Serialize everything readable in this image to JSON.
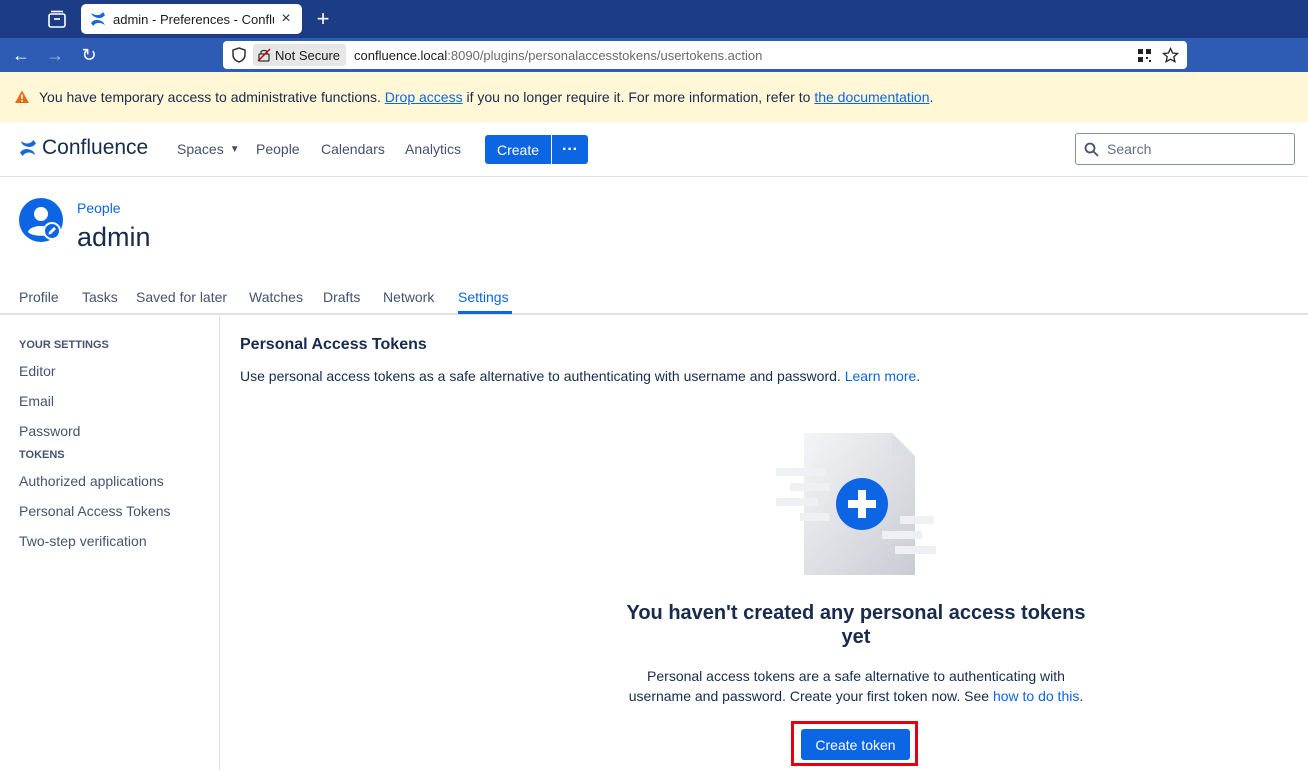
{
  "browser": {
    "tab_title": "admin - Preferences - Conflue",
    "security_label": "Not Secure",
    "url_host": "confluence.local",
    "url_rest": ":8090/plugins/personalaccesstokens/usertokens.action"
  },
  "banner": {
    "text_before": "You have temporary access to administrative functions. ",
    "link1": "Drop access",
    "text_middle": " if you no longer require it. For more information, refer to ",
    "link2": "the documentation",
    "text_after": "."
  },
  "header": {
    "logo_text": "Confluence",
    "nav": {
      "spaces": "Spaces",
      "people": "People",
      "calendars": "Calendars",
      "analytics": "Analytics"
    },
    "create_label": "Create",
    "more_label": "···",
    "search_placeholder": "Search"
  },
  "profile": {
    "breadcrumb": "People",
    "name": "admin",
    "tabs": [
      "Profile",
      "Tasks",
      "Saved for later",
      "Watches",
      "Drafts",
      "Network",
      "Settings"
    ]
  },
  "sidebar": {
    "heading_settings": "YOUR SETTINGS",
    "settings_items": [
      "Editor",
      "Email",
      "Password"
    ],
    "heading_tokens": "TOKENS",
    "token_items": [
      "Authorized applications",
      "Personal Access Tokens",
      "Two-step verification"
    ]
  },
  "main": {
    "title": "Personal Access Tokens",
    "description": "Use personal access tokens as a safe alternative to authenticating with username and password. ",
    "learn_more": "Learn more",
    "desc_end": ".",
    "empty_title": "You haven't created any personal access tokens yet",
    "empty_desc": "Personal access tokens are a safe alternative to authenticating with username and password. Create your first token now. See ",
    "how_to_link": "how to do this",
    "empty_desc_end": ".",
    "create_token_label": "Create token"
  },
  "colors": {
    "brand_blue": "#0c66e4",
    "tabbar": "#1c3d86",
    "navbar": "#2e5bb4",
    "banner_bg": "#fff7d6",
    "highlight": "#e3000f"
  }
}
